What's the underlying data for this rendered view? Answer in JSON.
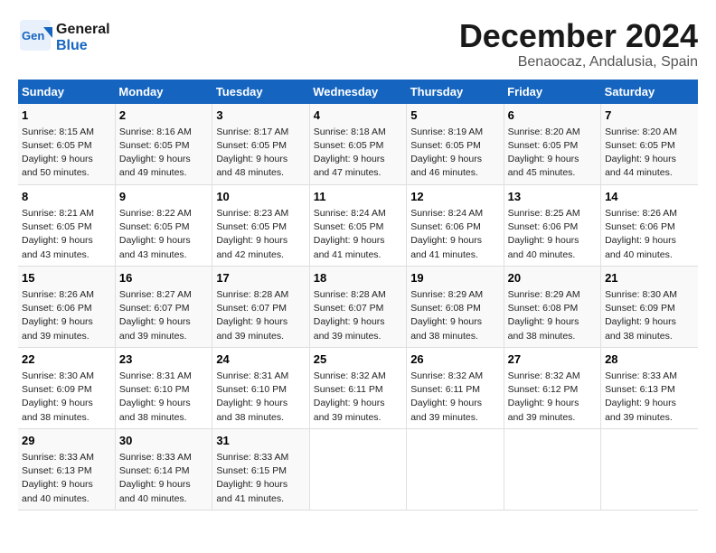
{
  "logo": {
    "line1": "General",
    "line2": "Blue"
  },
  "title": "December 2024",
  "subtitle": "Benaocaz, Andalusia, Spain",
  "weekdays": [
    "Sunday",
    "Monday",
    "Tuesday",
    "Wednesday",
    "Thursday",
    "Friday",
    "Saturday"
  ],
  "weeks": [
    [
      {
        "day": 1,
        "sunrise": "8:15 AM",
        "sunset": "6:05 PM",
        "daylight": "9 hours and 50 minutes."
      },
      {
        "day": 2,
        "sunrise": "8:16 AM",
        "sunset": "6:05 PM",
        "daylight": "9 hours and 49 minutes."
      },
      {
        "day": 3,
        "sunrise": "8:17 AM",
        "sunset": "6:05 PM",
        "daylight": "9 hours and 48 minutes."
      },
      {
        "day": 4,
        "sunrise": "8:18 AM",
        "sunset": "6:05 PM",
        "daylight": "9 hours and 47 minutes."
      },
      {
        "day": 5,
        "sunrise": "8:19 AM",
        "sunset": "6:05 PM",
        "daylight": "9 hours and 46 minutes."
      },
      {
        "day": 6,
        "sunrise": "8:20 AM",
        "sunset": "6:05 PM",
        "daylight": "9 hours and 45 minutes."
      },
      {
        "day": 7,
        "sunrise": "8:20 AM",
        "sunset": "6:05 PM",
        "daylight": "9 hours and 44 minutes."
      }
    ],
    [
      {
        "day": 8,
        "sunrise": "8:21 AM",
        "sunset": "6:05 PM",
        "daylight": "9 hours and 43 minutes."
      },
      {
        "day": 9,
        "sunrise": "8:22 AM",
        "sunset": "6:05 PM",
        "daylight": "9 hours and 43 minutes."
      },
      {
        "day": 10,
        "sunrise": "8:23 AM",
        "sunset": "6:05 PM",
        "daylight": "9 hours and 42 minutes."
      },
      {
        "day": 11,
        "sunrise": "8:24 AM",
        "sunset": "6:05 PM",
        "daylight": "9 hours and 41 minutes."
      },
      {
        "day": 12,
        "sunrise": "8:24 AM",
        "sunset": "6:06 PM",
        "daylight": "9 hours and 41 minutes."
      },
      {
        "day": 13,
        "sunrise": "8:25 AM",
        "sunset": "6:06 PM",
        "daylight": "9 hours and 40 minutes."
      },
      {
        "day": 14,
        "sunrise": "8:26 AM",
        "sunset": "6:06 PM",
        "daylight": "9 hours and 40 minutes."
      }
    ],
    [
      {
        "day": 15,
        "sunrise": "8:26 AM",
        "sunset": "6:06 PM",
        "daylight": "9 hours and 39 minutes."
      },
      {
        "day": 16,
        "sunrise": "8:27 AM",
        "sunset": "6:07 PM",
        "daylight": "9 hours and 39 minutes."
      },
      {
        "day": 17,
        "sunrise": "8:28 AM",
        "sunset": "6:07 PM",
        "daylight": "9 hours and 39 minutes."
      },
      {
        "day": 18,
        "sunrise": "8:28 AM",
        "sunset": "6:07 PM",
        "daylight": "9 hours and 39 minutes."
      },
      {
        "day": 19,
        "sunrise": "8:29 AM",
        "sunset": "6:08 PM",
        "daylight": "9 hours and 38 minutes."
      },
      {
        "day": 20,
        "sunrise": "8:29 AM",
        "sunset": "6:08 PM",
        "daylight": "9 hours and 38 minutes."
      },
      {
        "day": 21,
        "sunrise": "8:30 AM",
        "sunset": "6:09 PM",
        "daylight": "9 hours and 38 minutes."
      }
    ],
    [
      {
        "day": 22,
        "sunrise": "8:30 AM",
        "sunset": "6:09 PM",
        "daylight": "9 hours and 38 minutes."
      },
      {
        "day": 23,
        "sunrise": "8:31 AM",
        "sunset": "6:10 PM",
        "daylight": "9 hours and 38 minutes."
      },
      {
        "day": 24,
        "sunrise": "8:31 AM",
        "sunset": "6:10 PM",
        "daylight": "9 hours and 38 minutes."
      },
      {
        "day": 25,
        "sunrise": "8:32 AM",
        "sunset": "6:11 PM",
        "daylight": "9 hours and 39 minutes."
      },
      {
        "day": 26,
        "sunrise": "8:32 AM",
        "sunset": "6:11 PM",
        "daylight": "9 hours and 39 minutes."
      },
      {
        "day": 27,
        "sunrise": "8:32 AM",
        "sunset": "6:12 PM",
        "daylight": "9 hours and 39 minutes."
      },
      {
        "day": 28,
        "sunrise": "8:33 AM",
        "sunset": "6:13 PM",
        "daylight": "9 hours and 39 minutes."
      }
    ],
    [
      {
        "day": 29,
        "sunrise": "8:33 AM",
        "sunset": "6:13 PM",
        "daylight": "9 hours and 40 minutes."
      },
      {
        "day": 30,
        "sunrise": "8:33 AM",
        "sunset": "6:14 PM",
        "daylight": "9 hours and 40 minutes."
      },
      {
        "day": 31,
        "sunrise": "8:33 AM",
        "sunset": "6:15 PM",
        "daylight": "9 hours and 41 minutes."
      },
      null,
      null,
      null,
      null
    ]
  ],
  "labels": {
    "sunrise": "Sunrise:",
    "sunset": "Sunset:",
    "daylight": "Daylight:"
  }
}
